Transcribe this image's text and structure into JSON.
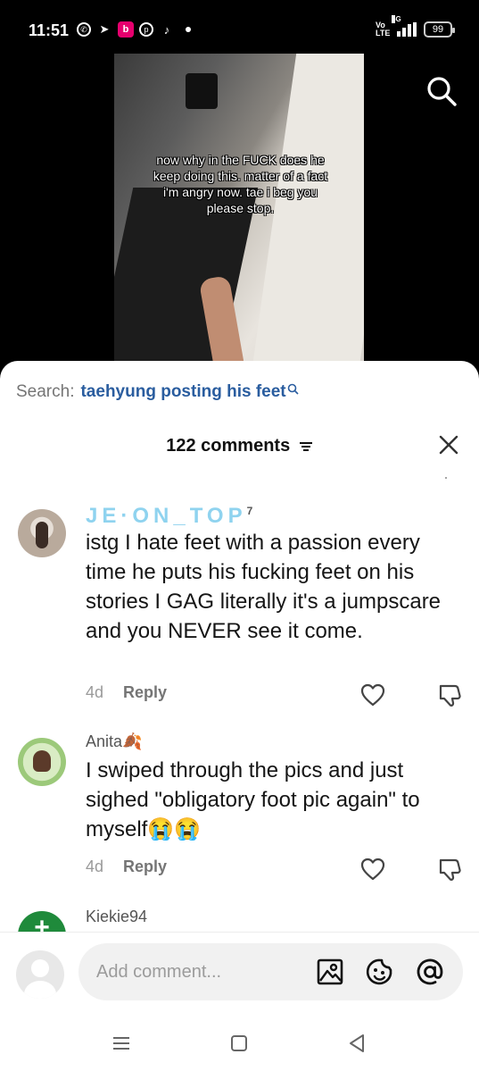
{
  "status": {
    "time": "11:51",
    "net_label": "5G",
    "volte_label": "Vo LTE",
    "battery": "99",
    "notification_icons": [
      "whatsapp-icon",
      "telegram-icon",
      "b-app-icon",
      "pinterest-icon",
      "tiktok-icon"
    ]
  },
  "video": {
    "caption": "now why in the FUCK does he keep doing this. matter of a fact i'm angry now. tae i beg you please stop."
  },
  "sheet": {
    "search_label": "Search:",
    "search_term": "taehyung posting his feet",
    "comments_count_label": "122 comments"
  },
  "comments": [
    {
      "username": "JE·ON_TOP",
      "badge": "7",
      "text": "istg I hate feet with a passion every time he puts his fucking feet on his stories I GAG literally it's a jumpscare and you NEVER see it come.",
      "age": "4d",
      "reply_label": "Reply"
    },
    {
      "username": "Anita🍂",
      "text": "I swiped through the pics and just sighed \"obligatory foot pic again\" to myself😭😭",
      "age": "4d",
      "reply_label": "Reply"
    },
    {
      "username": "Kiekie94"
    }
  ],
  "composer": {
    "placeholder": "Add comment..."
  }
}
